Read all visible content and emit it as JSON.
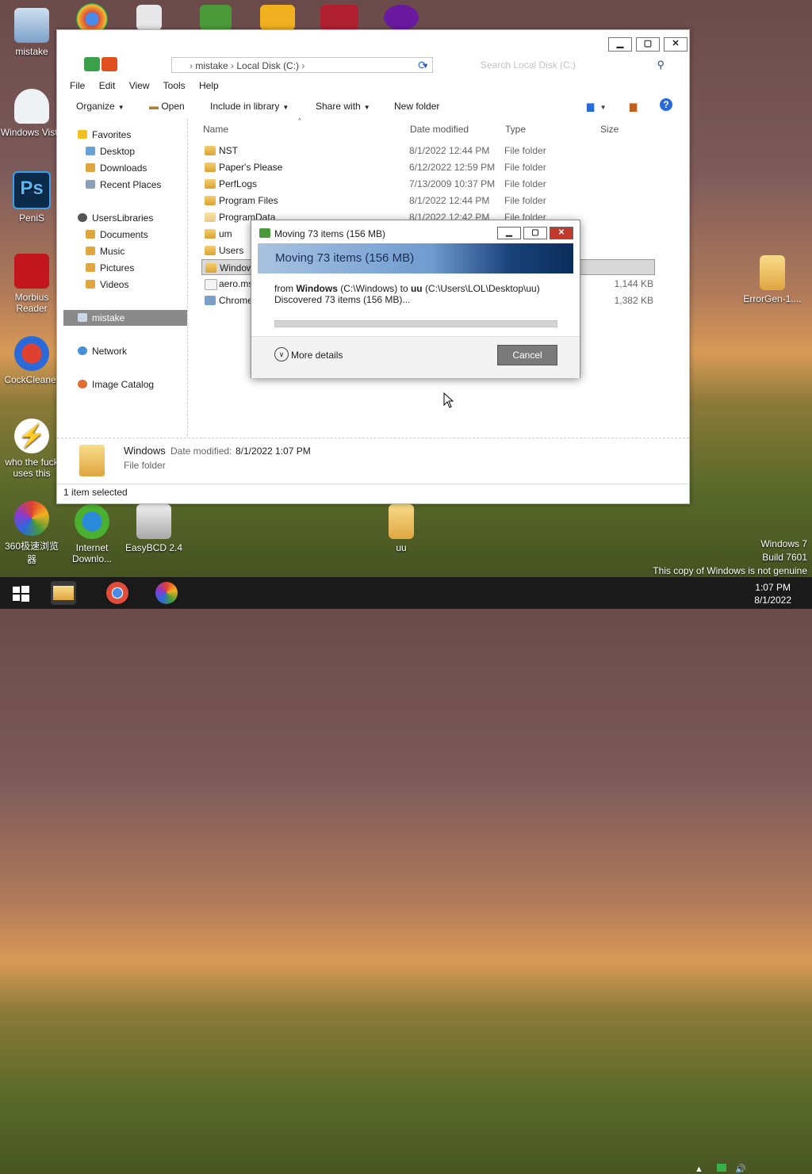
{
  "desktop": {
    "left_icons": [
      {
        "label": "mistake"
      },
      {
        "label": "Windows Vista"
      },
      {
        "label": "PeniS"
      },
      {
        "label": "Morbius Reader"
      },
      {
        "label": "CockCleaner"
      },
      {
        "label": "who the fuck uses this"
      },
      {
        "label": "360极速浏览器"
      }
    ],
    "bottom_icons": [
      {
        "label": "Internet Downlo..."
      },
      {
        "label": "EasyBCD 2.4"
      },
      {
        "label": "uu"
      }
    ],
    "right_icon": {
      "label": "ErrorGen-1...."
    }
  },
  "explorer": {
    "address": {
      "segments": [
        "mistake",
        "Local Disk (C:)"
      ]
    },
    "search_placeholder": "Search Local Disk (C:)",
    "menu": [
      "File",
      "Edit",
      "View",
      "Tools",
      "Help"
    ],
    "commands": {
      "organize": "Organize",
      "open": "Open",
      "include": "Include in library",
      "share": "Share with",
      "new_folder": "New folder"
    },
    "nav": {
      "favorites": "Favorites",
      "desktop": "Desktop",
      "downloads": "Downloads",
      "recent": "Recent Places",
      "libraries": "UsersLibraries",
      "documents": "Documents",
      "music": "Music",
      "pictures": "Pictures",
      "videos": "Videos",
      "computer": "mistake",
      "network": "Network",
      "catalog": "Image Catalog"
    },
    "columns": {
      "name": "Name",
      "date": "Date modified",
      "type": "Type",
      "size": "Size"
    },
    "rows": [
      {
        "name": "NST",
        "date": "8/1/2022 12:44 PM",
        "type": "File folder",
        "size": ""
      },
      {
        "name": "Paper's Please",
        "date": "6/12/2022 12:59 PM",
        "type": "File folder",
        "size": ""
      },
      {
        "name": "PerfLogs",
        "date": "7/13/2009 10:37 PM",
        "type": "File folder",
        "size": ""
      },
      {
        "name": "Program Files",
        "date": "8/1/2022 12:44 PM",
        "type": "File folder",
        "size": ""
      },
      {
        "name": "ProgramData",
        "date": "8/1/2022 12:42 PM",
        "type": "File folder",
        "size": ""
      },
      {
        "name": "um",
        "date": "",
        "type": "",
        "size": ""
      },
      {
        "name": "Users",
        "date": "",
        "type": "",
        "size": ""
      },
      {
        "name": "Windows",
        "date": "",
        "type": "",
        "size": ""
      },
      {
        "name": "aero.msstyles",
        "date": "",
        "type": "",
        "size": "1,144 KB"
      },
      {
        "name": "Chrome",
        "date": "",
        "type": "",
        "size": "1,382 KB"
      }
    ],
    "details": {
      "name": "Windows",
      "date_label": "Date modified:",
      "date": "8/1/2022 1:07 PM",
      "type": "File folder"
    },
    "status": "1 item selected"
  },
  "dialog": {
    "title": "Moving 73 items (156 MB)",
    "heading": "Moving 73 items (156 MB)",
    "from_prefix": "from",
    "from_name": "Windows",
    "from_path": "(C:\\Windows)",
    "to_prefix": "to",
    "to_name": "uu",
    "to_path": "(C:\\Users\\LOL\\Desktop\\uu)",
    "discovered": "Discovered 73 items (156 MB)...",
    "progress": 0.0,
    "more_details": "More details",
    "cancel": "Cancel"
  },
  "watermark": {
    "line1": "Windows 7",
    "line2": "Build 7601",
    "line3": "This copy of Windows is not genuine"
  },
  "clock": {
    "time": "1:07 PM",
    "date": "8/1/2022"
  }
}
